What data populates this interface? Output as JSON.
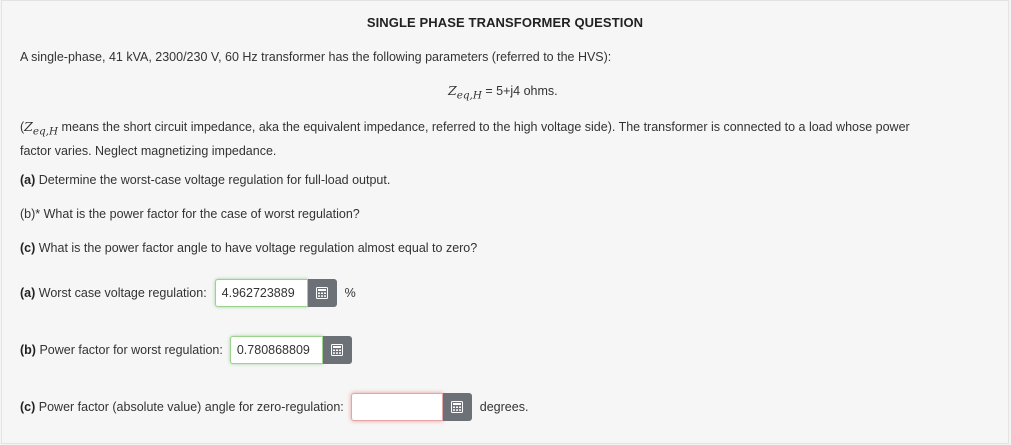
{
  "title": "SINGLE PHASE TRANSFORMER QUESTION",
  "intro": "A single-phase, 41 kVA, 2300/230 V, 60 Hz transformer has the following parameters (referred to the HVS):",
  "equation": {
    "symbol": "Z",
    "subscript": "eq,H",
    "equals": " = ",
    "value": "5+j4 ohms."
  },
  "note": {
    "open_paren": "(",
    "symbol": "Z",
    "subscript": "eq,H",
    "line1_rest": " means the short circuit impedance, aka the equivalent impedance, referred to the high voltage side). The transformer is connected to a load whose power",
    "line2": "factor varies. Neglect magnetizing impedance."
  },
  "questions": {
    "a_tag": "(a)",
    "a_text": " Determine the worst-case voltage regulation for full-load output.",
    "b_text": "(b)* What is the power factor for the case of worst regulation?",
    "c_tag": "(c)",
    "c_text": " What is the power factor angle to have voltage regulation almost equal to zero?"
  },
  "answers": {
    "a": {
      "tag": "(a)",
      "label": " Worst case voltage regulation:",
      "value": "4.962723889",
      "unit": "%"
    },
    "b": {
      "tag": "(b)",
      "label": " Power factor for worst regulation:",
      "value": "0.780868809"
    },
    "c": {
      "tag": "(c)",
      "label": " Power factor (absolute value) angle for zero-regulation:",
      "value": "",
      "unit": "degrees."
    }
  },
  "icons": {
    "calculator": "calculator-icon"
  },
  "colors": {
    "correct_border": "#9cd28d",
    "empty_border": "#e6a6a6",
    "calc_button": "#6b7177"
  }
}
